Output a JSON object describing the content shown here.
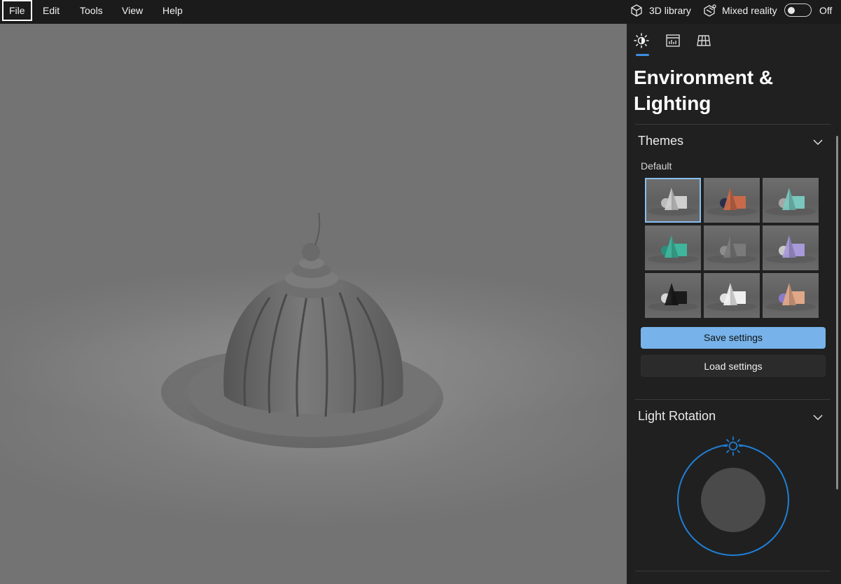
{
  "menu": {
    "items": [
      "File",
      "Edit",
      "Tools",
      "View",
      "Help"
    ],
    "active_index": 0
  },
  "top_right": {
    "library_label": "3D library",
    "mixed_reality_label": "Mixed reality",
    "toggle_state_label": "Off",
    "toggle_on": false
  },
  "panel": {
    "tabs": [
      {
        "icon": "sun-icon",
        "selected": true
      },
      {
        "icon": "chart-icon",
        "selected": false
      },
      {
        "icon": "grid-icon",
        "selected": false
      }
    ],
    "title": "Environment & Lighting",
    "themes": {
      "heading": "Themes",
      "selected_theme_label": "Default",
      "selected_index": 0,
      "swatches": [
        {
          "accent": "#cfcfcf",
          "accent2": "#bdbdbd"
        },
        {
          "accent": "#c86a4a",
          "accent2": "#2a2f4a"
        },
        {
          "accent": "#7ac7be",
          "accent2": "#a6a6a6"
        },
        {
          "accent": "#3fb59c",
          "accent2": "#2c8f7c"
        },
        {
          "accent": "#7a7a7a",
          "accent2": "#8c8c8c"
        },
        {
          "accent": "#a89ad8",
          "accent2": "#c8c8c8"
        },
        {
          "accent": "#1a1a1a",
          "accent2": "#d8d8d8"
        },
        {
          "accent": "#f0f0f0",
          "accent2": "#e0e0e0"
        },
        {
          "accent": "#e0a888",
          "accent2": "#8a7ac8"
        }
      ]
    },
    "save_button": "Save settings",
    "load_button": "Load settings",
    "light_rotation": {
      "heading": "Light Rotation",
      "accent": "#1f7fd6"
    }
  },
  "colors": {
    "accent": "#3c8ee0",
    "primary_button": "#77b3ea"
  }
}
